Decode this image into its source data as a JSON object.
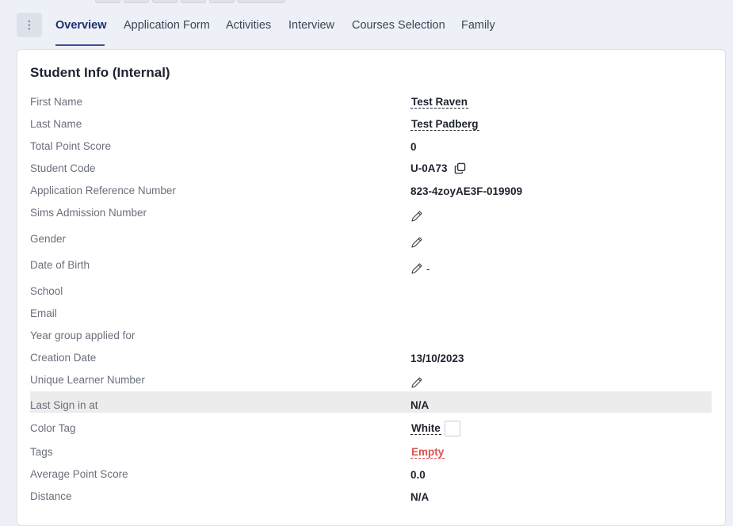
{
  "tabs": {
    "menu_icon": "more-vertical-icon",
    "items": [
      {
        "label": "Overview",
        "active": true
      },
      {
        "label": "Application Form"
      },
      {
        "label": "Activities"
      },
      {
        "label": "Interview"
      },
      {
        "label": "Courses Selection"
      },
      {
        "label": "Family"
      }
    ]
  },
  "card": {
    "title": "Student Info (Internal)",
    "fields": {
      "first_name": {
        "label": "First Name",
        "value": "Test Raven"
      },
      "last_name": {
        "label": "Last Name",
        "value": "Test Padberg"
      },
      "total_point_score": {
        "label": "Total Point Score",
        "value": "0"
      },
      "student_code": {
        "label": "Student Code",
        "value": "U-0A73"
      },
      "application_reference_number": {
        "label": "Application Reference Number",
        "value": "823-4zoyAE3F-019909"
      },
      "sims_admission_number": {
        "label": "Sims Admission Number"
      },
      "gender": {
        "label": "Gender"
      },
      "date_of_birth": {
        "label": "Date of Birth",
        "value": "-"
      },
      "school": {
        "label": "School"
      },
      "email": {
        "label": "Email"
      },
      "year_group_applied_for": {
        "label": "Year group applied for"
      },
      "creation_date": {
        "label": "Creation Date",
        "value": "13/10/2023"
      },
      "unique_learner_number": {
        "label": "Unique Learner Number"
      },
      "last_sign_in_at": {
        "label": "Last Sign in at",
        "value": "N/A"
      },
      "color_tag": {
        "label": "Color Tag",
        "value": "White"
      },
      "tags": {
        "label": "Tags",
        "value": "Empty"
      },
      "average_point_score": {
        "label": "Average Point Score",
        "value": "0.0"
      },
      "distance": {
        "label": "Distance",
        "value": "N/A"
      }
    }
  },
  "colors": {
    "active_tab": "#1c2f6e",
    "tab_underline": "#3a4fa0",
    "empty_tag": "#d9534f",
    "highlight_row": "#ececec"
  }
}
